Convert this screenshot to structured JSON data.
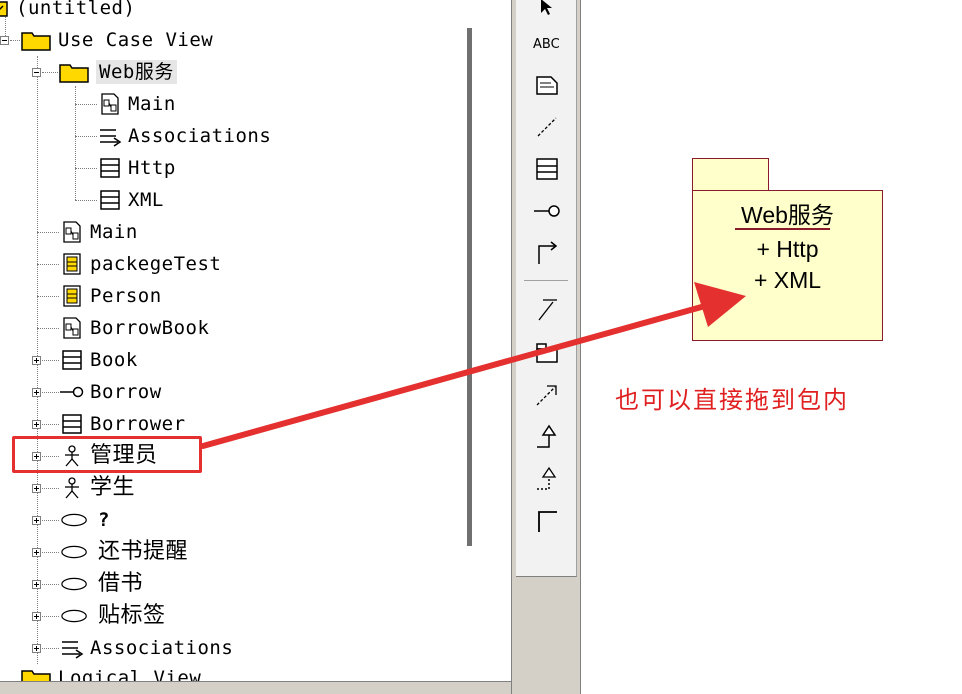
{
  "colors": {
    "highlight": "#e53030",
    "package_fill": "#ffffcc",
    "package_border": "#8b1a2a",
    "annotation_text": "#e02020"
  },
  "tree": {
    "root_label": "(untitled)",
    "use_case_view_label": "Use Case View",
    "package_label": "Web服务",
    "package_children": [
      {
        "label": "Main",
        "icon": "class-diagram-icon"
      },
      {
        "label": "Associations",
        "icon": "associations-icon"
      },
      {
        "label": "Http",
        "icon": "class-icon"
      },
      {
        "label": "XML",
        "icon": "class-icon"
      }
    ],
    "items": [
      {
        "label": "Main",
        "icon": "class-diagram-icon",
        "expandable": false
      },
      {
        "label": "packegeTest",
        "icon": "interaction-diagram-icon",
        "expandable": false
      },
      {
        "label": "Person",
        "icon": "interaction-diagram-icon",
        "expandable": false
      },
      {
        "label": "BorrowBook",
        "icon": "class-diagram-icon",
        "expandable": false
      },
      {
        "label": "Book",
        "icon": "class-icon",
        "expandable": true
      },
      {
        "label": "Borrow",
        "icon": "interface-icon",
        "expandable": true
      },
      {
        "label": "Borrower",
        "icon": "class-icon",
        "expandable": true
      },
      {
        "label": "管理员",
        "icon": "actor-icon",
        "expandable": true
      },
      {
        "label": "学生",
        "icon": "actor-icon",
        "expandable": true
      },
      {
        "label": "?",
        "icon": "use-case-icon",
        "expandable": true
      },
      {
        "label": "还书提醒",
        "icon": "use-case-icon",
        "expandable": true
      },
      {
        "label": "借书",
        "icon": "use-case-icon",
        "expandable": true
      },
      {
        "label": "贴标签",
        "icon": "use-case-icon",
        "expandable": true
      },
      {
        "label": "Associations",
        "icon": "associations-icon",
        "expandable": true
      }
    ],
    "logical_view_label": "Logical View"
  },
  "toolbox": {
    "tools": [
      "selector-icon",
      "text-box-icon",
      "note-icon",
      "anchor-note-icon",
      "class-icon",
      "interface-icon",
      "unidirectional-association-icon",
      "association-class-icon",
      "package-icon",
      "dependency-icon",
      "generalization-icon",
      "realize-icon",
      "corner-icon"
    ]
  },
  "diagram": {
    "package_name": "Web服务",
    "members": [
      "+ Http",
      "+ XML"
    ],
    "annotation": "也可以直接拖到包内"
  }
}
